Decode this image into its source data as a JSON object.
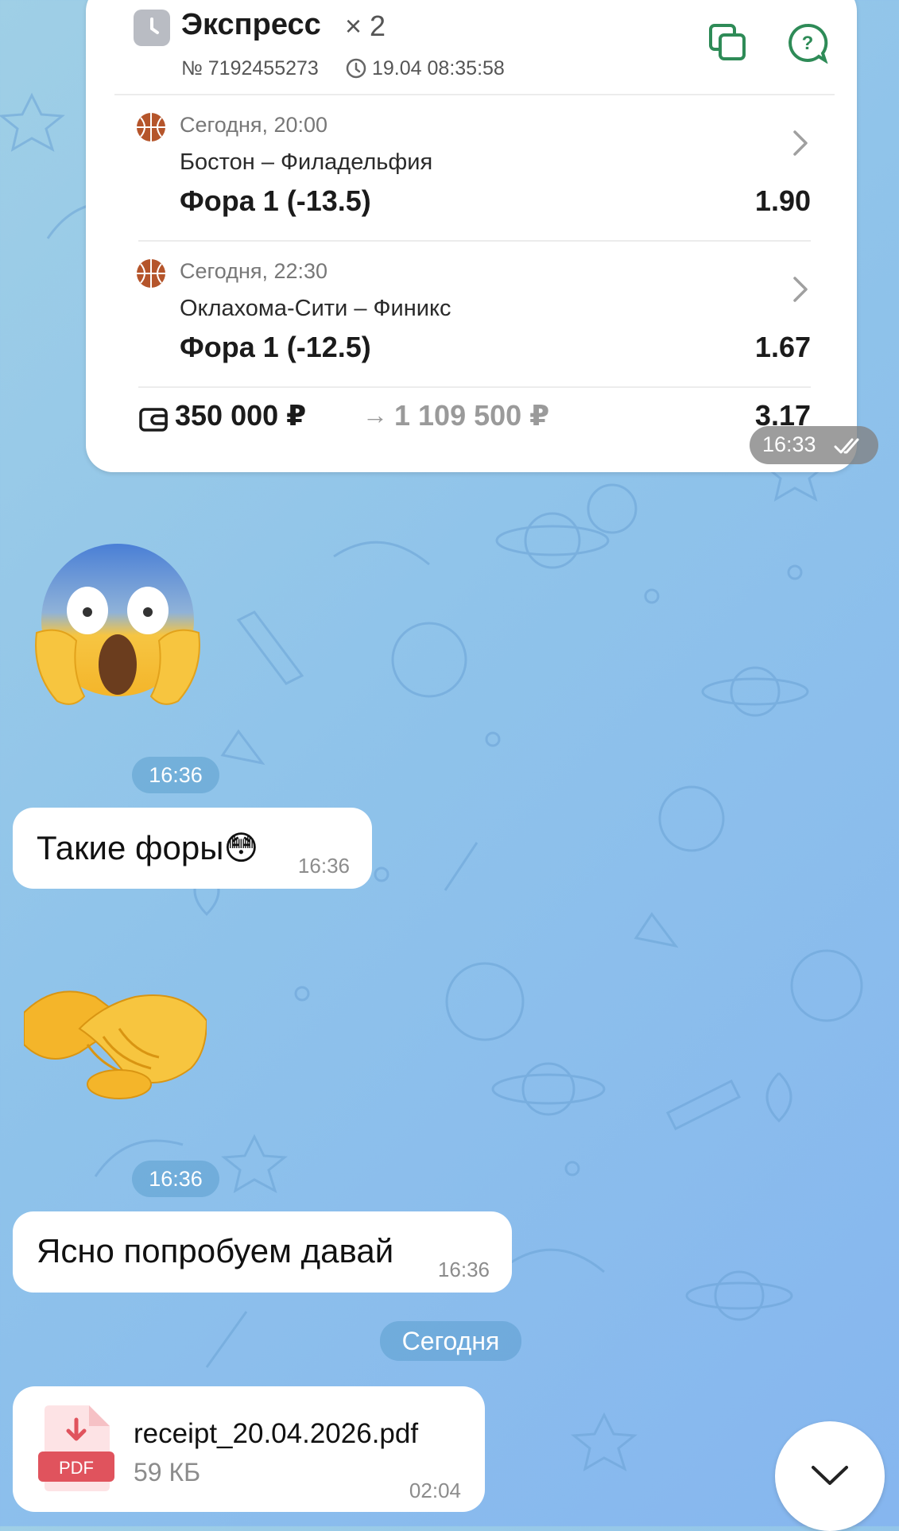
{
  "bet": {
    "title": "Экспресс",
    "count": "× 2",
    "number": "№ 7192455273",
    "datetime": "19.04 08:35:58",
    "events": [
      {
        "time": "Сегодня, 20:00",
        "teams": "Бостон – Филадельфия",
        "bet": "Фора 1 (-13.5)",
        "odds": "1.90",
        "sport_icon": "basketball-icon"
      },
      {
        "time": "Сегодня, 22:30",
        "teams": "Оклахома-Сити – Финикс",
        "bet": "Фора 1 (-12.5)",
        "odds": "1.67",
        "sport_icon": "basketball-icon"
      }
    ],
    "stake": "350 000 ₽",
    "arrow": "→",
    "payout": "1 109 500 ₽",
    "total_odds": "3.17"
  },
  "messages": {
    "card_time": "16:33",
    "emoji1_time": "16:36",
    "text1": "Такие форы😳",
    "text1_time": "16:36",
    "emoji2_time": "16:36",
    "text2": "Ясно попробуем давай",
    "text2_time": "16:36",
    "date_divider": "Сегодня",
    "file_name": "receipt_20.04.2026.pdf",
    "file_size": "59 КБ",
    "file_time": "02:04",
    "file_type": "PDF"
  },
  "colors": {
    "accent_green": "#2e8b57",
    "pdf_red": "#e0535d",
    "basketball": "#b5552b"
  }
}
